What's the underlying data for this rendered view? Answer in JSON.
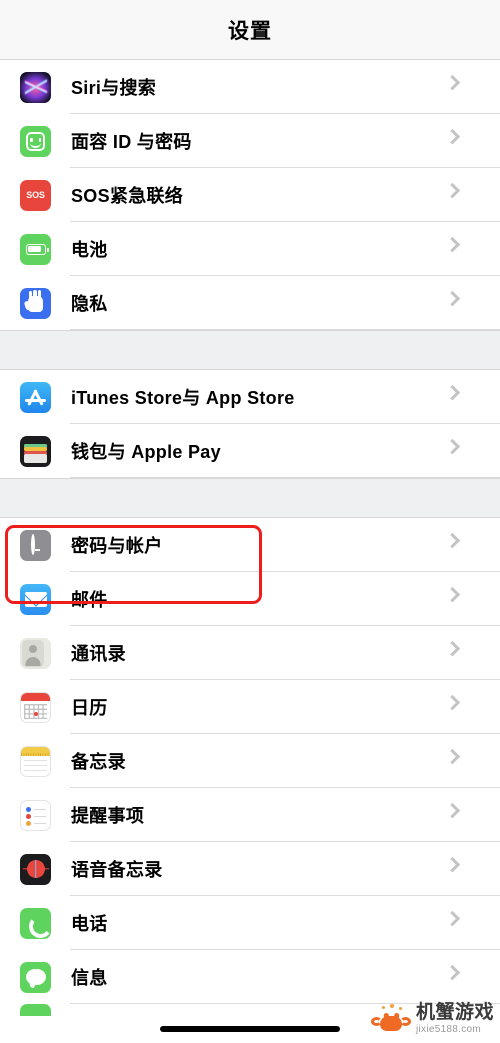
{
  "navbar": {
    "title": "设置"
  },
  "groups": [
    {
      "id": "group-1",
      "rows": [
        {
          "label": "Siri与搜索",
          "icon": "siri-icon",
          "icon_class": "ic-siri"
        },
        {
          "label": "面容 ID 与密码",
          "icon": "faceid-icon",
          "icon_class": "ic-faceid"
        },
        {
          "label": "SOS紧急联络",
          "icon": "sos-icon",
          "icon_class": "ic-sos",
          "icon_text": "SOS"
        },
        {
          "label": "电池",
          "icon": "battery-icon",
          "icon_class": "ic-batt"
        },
        {
          "label": "隐私",
          "icon": "privacy-hand-icon",
          "icon_class": "ic-priv"
        }
      ]
    },
    {
      "id": "group-2",
      "rows": [
        {
          "label": "iTunes Store与 App Store",
          "icon": "app-store-icon",
          "icon_class": "ic-appstore"
        },
        {
          "label": "钱包与 Apple Pay",
          "icon": "wallet-icon",
          "icon_class": "ic-wallet"
        }
      ]
    },
    {
      "id": "group-3",
      "rows": [
        {
          "label": "密码与帐户",
          "icon": "key-icon",
          "icon_class": "ic-key",
          "highlighted": true
        },
        {
          "label": "邮件",
          "icon": "mail-icon",
          "icon_class": "ic-mail"
        },
        {
          "label": "通讯录",
          "icon": "contacts-icon",
          "icon_class": "ic-contacts"
        },
        {
          "label": "日历",
          "icon": "calendar-icon",
          "icon_class": "ic-cal"
        },
        {
          "label": "备忘录",
          "icon": "notes-icon",
          "icon_class": "ic-notes"
        },
        {
          "label": "提醒事项",
          "icon": "reminders-icon",
          "icon_class": "ic-rem"
        },
        {
          "label": "语音备忘录",
          "icon": "voice-memos-icon",
          "icon_class": "ic-voice"
        },
        {
          "label": "电话",
          "icon": "phone-icon",
          "icon_class": "ic-phone"
        },
        {
          "label": "信息",
          "icon": "messages-icon",
          "icon_class": "ic-msg"
        }
      ]
    }
  ],
  "highlight": {
    "color": "#ee1d1d",
    "target_label": "密码与帐户"
  },
  "watermark": {
    "name": "机蟹游戏",
    "url": "jixie5188.com"
  },
  "colors": {
    "navbar_bg": "#f8f8f8",
    "group_gap_bg": "#eff0f2",
    "separator": "#dcdcdd",
    "chevron": "#c4c4c6",
    "row_bg": "#ffffff",
    "label_text": "#000000"
  }
}
